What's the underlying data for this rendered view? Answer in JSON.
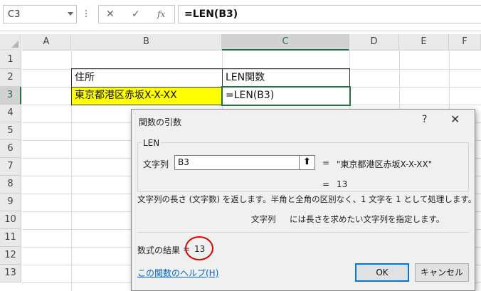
{
  "formula_bar": {
    "name_box": "C3",
    "cancel_icon": "✕",
    "enter_icon": "✓",
    "fx_icon": "fx",
    "formula": "=LEN(B3)"
  },
  "grid": {
    "columns": [
      "A",
      "B",
      "C",
      "D",
      "E",
      "F"
    ],
    "rows": [
      "1",
      "2",
      "3",
      "4",
      "5",
      "6",
      "7",
      "8",
      "9",
      "10",
      "11",
      "12",
      "13"
    ],
    "selected_column": "C",
    "selected_row": "3",
    "cells": {
      "B2": "住所",
      "C2": "LEN関数",
      "B3": "東京都港区赤坂X-X-XX",
      "C3": "=LEN(B3)"
    }
  },
  "dialog": {
    "title": "関数の引数",
    "help_icon": "?",
    "close_icon": "✕",
    "function_name": "LEN",
    "arg_label": "文字列",
    "arg_value": "B3",
    "arg_collapse_icon": "⬆",
    "arg_eq": "=",
    "arg_result": "\"東京都港区赤坂X-X-XX\"",
    "result_eq": "=",
    "result_value": "13",
    "description": "文字列の長さ (文字数) を返します。半角と全角の区別なく、1 文字を 1 として処理します。",
    "arg_desc_name": "文字列",
    "arg_desc_text": "には長さを求めたい文字列を指定します。",
    "formula_result_label": "数式の結果",
    "formula_result_eq": "=",
    "formula_result_value": "13",
    "help_link": "この関数のヘルプ(H)",
    "ok_label": "OK",
    "cancel_label": "キャンセル"
  },
  "colors": {
    "selection_green": "#217346",
    "highlight_yellow": "#ffff00",
    "annotation_red": "#e00000",
    "link_blue": "#0563c1"
  }
}
